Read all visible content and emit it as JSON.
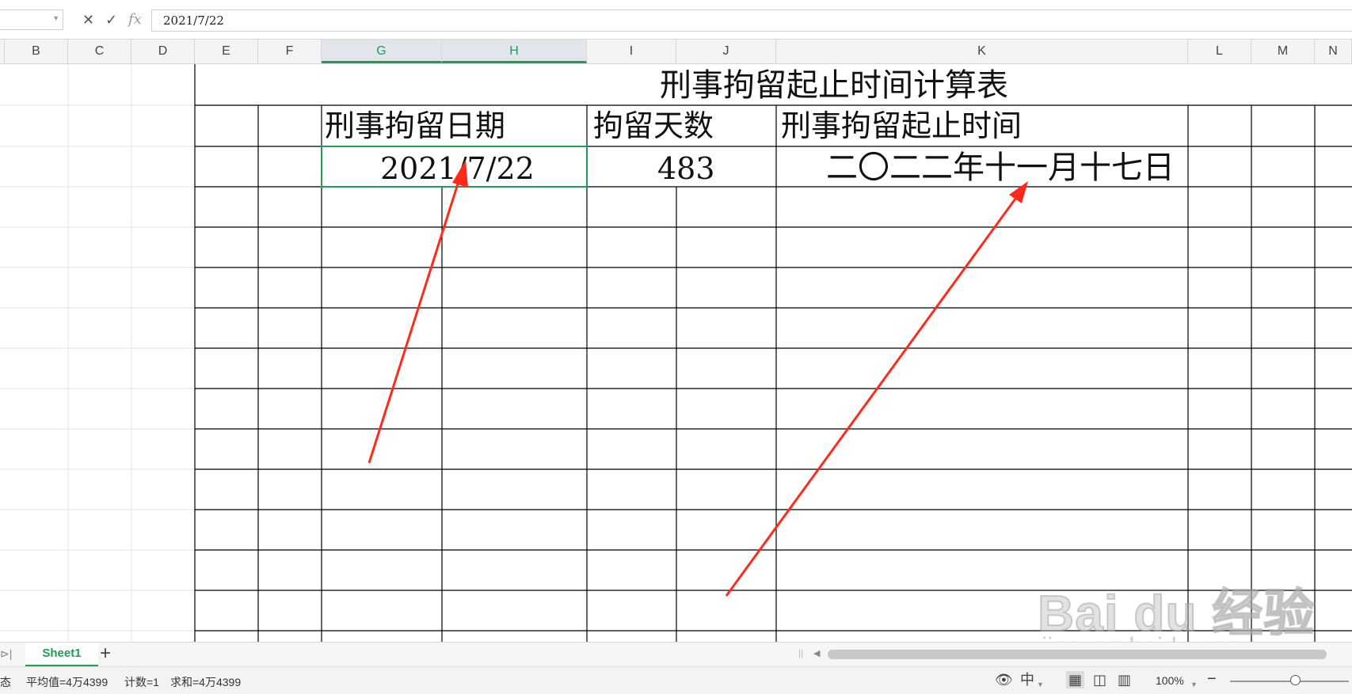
{
  "formula_bar": {
    "cancel_icon": "close-icon",
    "confirm_icon": "check-icon",
    "fx_label": "fx",
    "value": "2021/7/22"
  },
  "columns": [
    "B",
    "C",
    "D",
    "E",
    "F",
    "G",
    "H",
    "I",
    "J",
    "K",
    "L",
    "M",
    "N"
  ],
  "selected_columns": [
    "G",
    "H"
  ],
  "sheet": {
    "title": "刑事拘留起止时间计算表",
    "headers": {
      "date": "刑事拘留日期",
      "days": "拘留天数",
      "range": "刑事拘留起止时间"
    },
    "row1": {
      "date": "2021/7/22",
      "days": "483",
      "range": "二〇二二年十一月十七日"
    }
  },
  "annotations": {
    "arrow_color": "#ff2a1a",
    "arrow_count": 2
  },
  "watermark": {
    "logo": "Bai du 经验",
    "url": "jingyan.baidu.com"
  },
  "tabs": {
    "sheet_name": "Sheet1",
    "add_label": "+",
    "nav_last": "⊳|"
  },
  "status_bar": {
    "mode": "态",
    "average": "平均值=4万4399",
    "count": "计数=1",
    "sum": "求和=4万4399",
    "zoom": "100%",
    "zoom_minus": "−"
  },
  "colors": {
    "accent": "#1f9d55",
    "gridline": "#e3e3e3",
    "border": "#000000"
  }
}
